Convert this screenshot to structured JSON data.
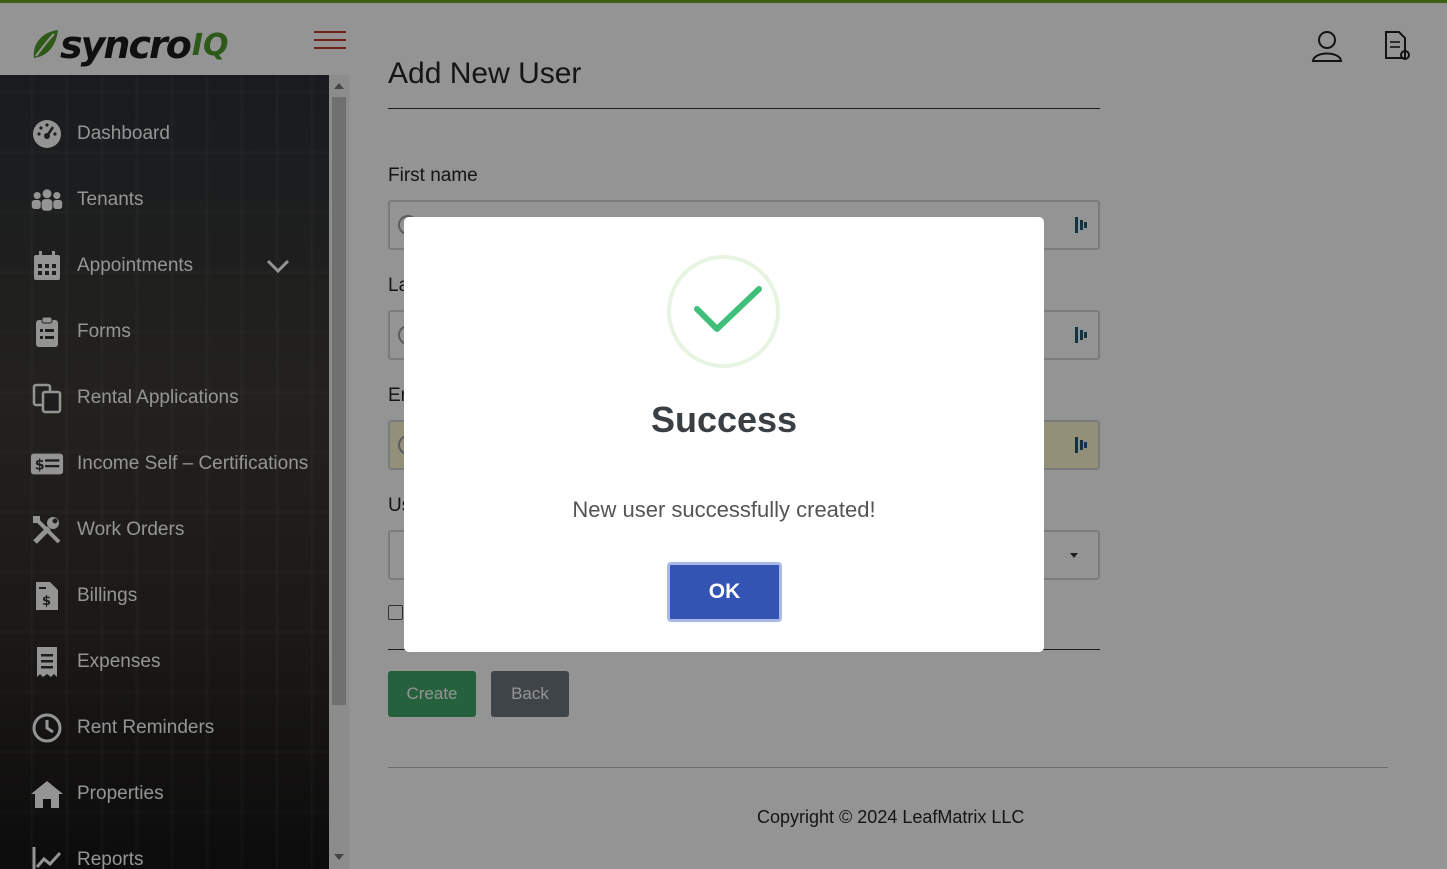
{
  "header": {
    "logo_main": "syncro",
    "logo_accent": "IQ",
    "menu_icon": "hamburger-icon",
    "user_icon": "user-icon",
    "doc_icon": "document-settings-icon",
    "accent_color": "#6aa52b"
  },
  "sidebar": {
    "items": [
      {
        "label": "Dashboard",
        "icon": "dashboard-icon"
      },
      {
        "label": "Tenants",
        "icon": "users-icon"
      },
      {
        "label": "Appointments",
        "icon": "calendar-icon"
      },
      {
        "label": "Forms",
        "icon": "clipboard-icon"
      },
      {
        "label": "Rental Applications",
        "icon": "copy-icon"
      },
      {
        "label": "Income Self – Certifications",
        "icon": "money-bill-icon"
      },
      {
        "label": "Work Orders",
        "icon": "tools-icon"
      },
      {
        "label": "Billings",
        "icon": "invoice-icon"
      },
      {
        "label": "Expenses",
        "icon": "receipt-icon"
      },
      {
        "label": "Rent Reminders",
        "icon": "clock-icon"
      },
      {
        "label": "Properties",
        "icon": "home-icon"
      },
      {
        "label": "Reports",
        "icon": "chart-line-icon"
      }
    ]
  },
  "form": {
    "page_title": "Add New User",
    "first_name_label": "First name",
    "last_name_label": "La",
    "email_label": "Em",
    "user_type_label": "Us",
    "create_label": "Create",
    "back_label": "Back"
  },
  "footer": {
    "copyright": "Copyright © 2024 LeafMatrix LLC"
  },
  "modal": {
    "title": "Success",
    "message": "New user successfully created!",
    "ok_label": "OK",
    "icon": "success-check-icon",
    "check_color": "#3fbf7a",
    "button_color": "#3454b4"
  }
}
